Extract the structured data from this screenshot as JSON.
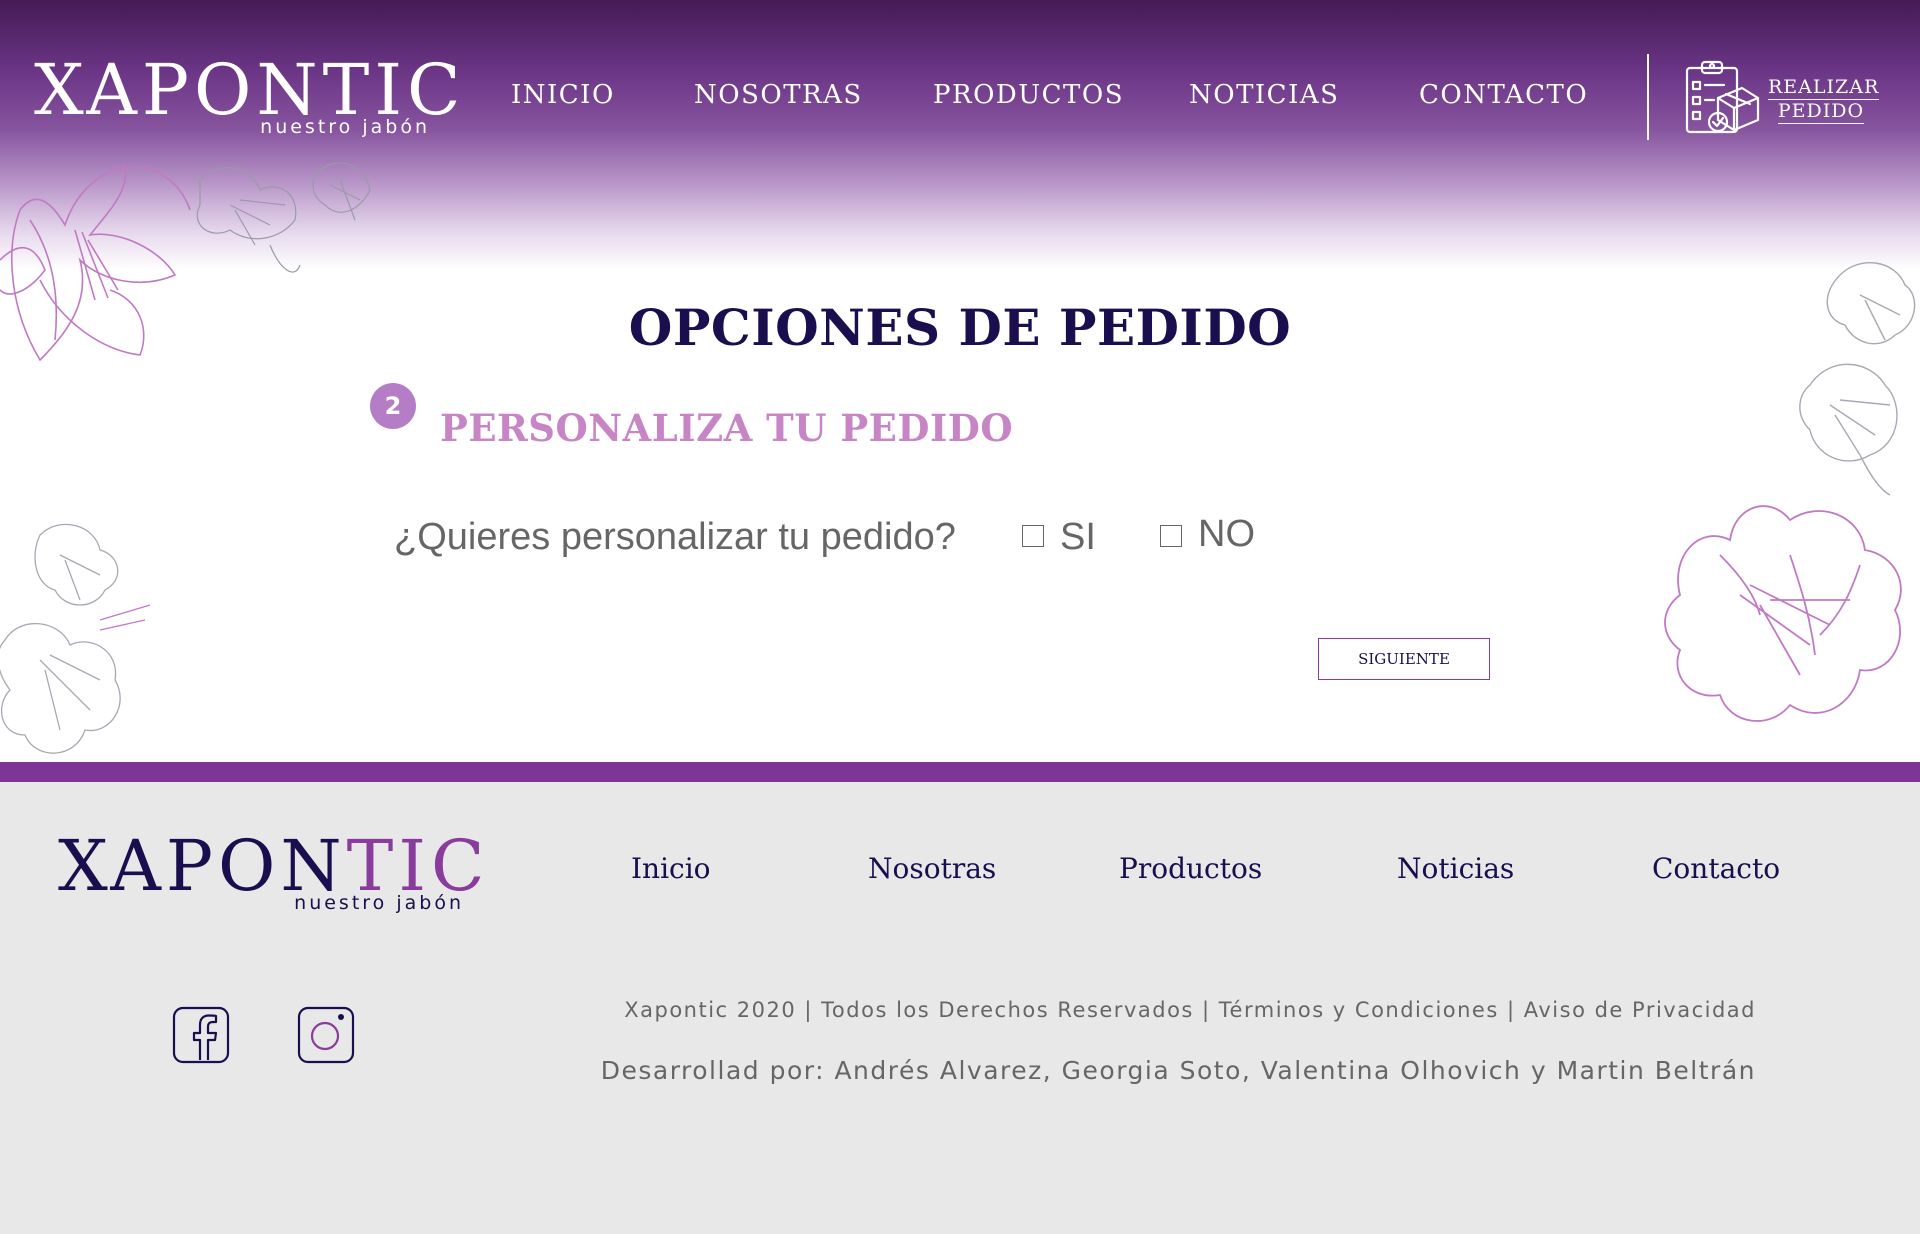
{
  "header": {
    "logo": {
      "name": "XAPONTIC",
      "tagline": "nuestro jabón"
    },
    "nav": [
      {
        "label": "INICIO"
      },
      {
        "label": "NOSOTRAS"
      },
      {
        "label": "PRODUCTOS"
      },
      {
        "label": "NOTICIAS"
      },
      {
        "label": "CONTACTO"
      }
    ],
    "order": {
      "line1": "REALIZAR",
      "line2": "PEDIDO",
      "icon": "clipboard-checklist-box-icon"
    }
  },
  "main": {
    "title": "OPCIONES DE PEDIDO",
    "step": {
      "number": "2",
      "title": "PERSONALIZA TU PEDIDO"
    },
    "question": "¿Quieres personalizar tu pedido?",
    "options": [
      {
        "label": "SI",
        "checked": false
      },
      {
        "label": "NO",
        "checked": false
      }
    ],
    "next_label": "SIGUIENTE"
  },
  "footer": {
    "logo": {
      "name_part1": "XAPON",
      "name_part2": "TIC",
      "tagline": "nuestro jabón"
    },
    "nav": [
      {
        "label": "Inicio"
      },
      {
        "label": "Nosotras"
      },
      {
        "label": "Productos"
      },
      {
        "label": "Noticias"
      },
      {
        "label": "Contacto"
      }
    ],
    "social": [
      {
        "icon": "facebook-icon"
      },
      {
        "icon": "instagram-icon"
      }
    ],
    "legal": {
      "copyright": "Xapontic 2020",
      "rights": "Todos los Derechos Reservados",
      "terms": "Términos y Condiciones",
      "privacy": "Aviso de Privacidad",
      "separator": " | "
    },
    "credits": "Desarrollad por: Andrés Alvarez, Georgia Soto, Valentina Olhovich y Martin Beltrán"
  },
  "colors": {
    "header_dark": "#451a55",
    "brand_purple": "#7d3596",
    "accent_pink": "#c785c6",
    "navy": "#1a0e4f",
    "footer_bg": "#e8e8e8",
    "text_gray": "#666666"
  }
}
